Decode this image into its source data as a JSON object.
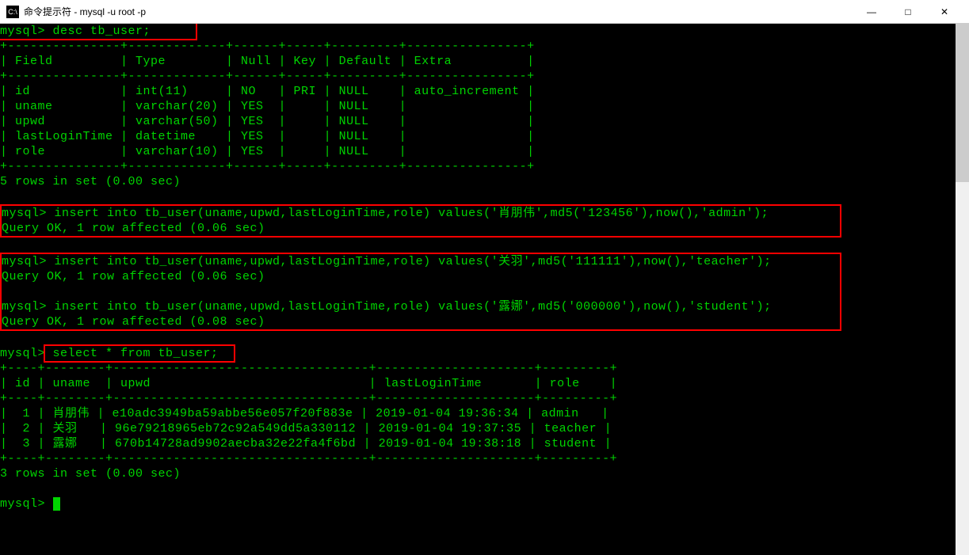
{
  "window": {
    "title": "命令提示符 - mysql  -u root -p",
    "icon_text": "C:\\",
    "min_icon": "—",
    "max_icon": "□",
    "close_icon": "✕"
  },
  "cmd1": {
    "prompt": "mysql>",
    "command": " desc tb_user;"
  },
  "desc_table": {
    "sep_top": "+---------------+-------------+------+-----+---------+----------------+",
    "header": "| Field         | Type        | Null | Key | Default | Extra          |",
    "sep_mid": "+---------------+-------------+------+-----+---------+----------------+",
    "row1": "| id            | int(11)     | NO   | PRI | NULL    | auto_increment |",
    "row2": "| uname         | varchar(20) | YES  |     | NULL    |                |",
    "row3": "| upwd          | varchar(50) | YES  |     | NULL    |                |",
    "row4": "| lastLoginTime | datetime    | YES  |     | NULL    |                |",
    "row5": "| role          | varchar(10) | YES  |     | NULL    |                |",
    "sep_bot": "+---------------+-------------+------+-----+---------+----------------+",
    "summary": "5 rows in set (0.00 sec)"
  },
  "insert1": {
    "line1": "mysql> insert into tb_user(uname,upwd,lastLoginTime,role) values('肖朋伟',md5('123456'),now(),'admin');",
    "line2": "Query OK, 1 row affected (0.06 sec)"
  },
  "insert2": {
    "line1": "mysql> insert into tb_user(uname,upwd,lastLoginTime,role) values('关羽',md5('111111'),now(),'teacher');",
    "line2": "Query OK, 1 row affected (0.06 sec)"
  },
  "insert3": {
    "line1": "mysql> insert into tb_user(uname,upwd,lastLoginTime,role) values('露娜',md5('000000'),now(),'student');",
    "line2": "Query OK, 1 row affected (0.08 sec)"
  },
  "cmd2": {
    "prompt": "mysql>",
    "command": " select * from tb_user;"
  },
  "select_table": {
    "sep_top": "+----+--------+----------------------------------+---------------------+---------+",
    "header": "| id | uname  | upwd                             | lastLoginTime       | role    |",
    "sep_mid": "+----+--------+----------------------------------+---------------------+---------+",
    "row1": "|  1 | 肖朋伟 | e10adc3949ba59abbe56e057f20f883e | 2019-01-04 19:36:34 | admin   |",
    "row2": "|  2 | 关羽   | 96e79218965eb72c92a549dd5a330112 | 2019-01-04 19:37:35 | teacher |",
    "row3": "|  3 | 露娜   | 670b14728ad9902aecba32e22fa4f6bd | 2019-01-04 19:38:18 | student |",
    "sep_bot": "+----+--------+----------------------------------+---------------------+---------+",
    "summary": "3 rows in set (0.00 sec)"
  },
  "final_prompt": "mysql>"
}
